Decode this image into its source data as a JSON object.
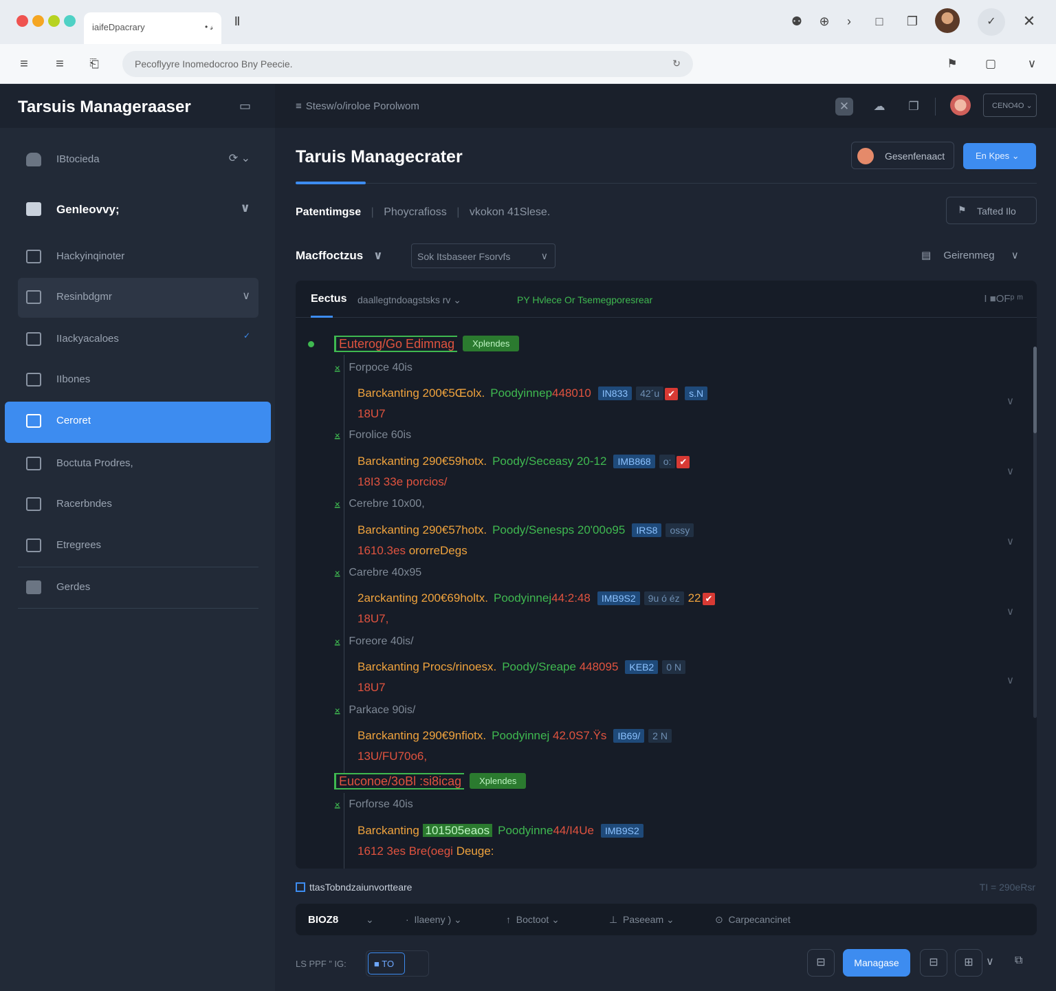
{
  "browser": {
    "tab_title": "iaifeDpacrary",
    "address": "Pecoflyyre Inomedocroo Bny Peecie.",
    "window_colors": [
      "#ef5350",
      "#f5a623",
      "#7ed321",
      "#4fd1c5"
    ]
  },
  "app": {
    "brand": "Tarsuis Manageraaser",
    "breadcrumb": "Stesw/o/iroloe  Porolwom",
    "top_select": "CENO4O",
    "page_title": "Taruis Managecrater",
    "header_button": "Gesenfenaact",
    "primary_button": "En Kpes",
    "sub_tabs": [
      "Patentimgse",
      "Phoycrafioss",
      "vkokon 41Slese."
    ],
    "tasks_button": "Tafted Ilo",
    "filter_label": "Macffoctzus",
    "filter_select": "Sok Itsbaseer Fsorvfs",
    "filter_right": "Geirenmeg"
  },
  "sidebar": {
    "items": [
      {
        "label": "IBtocieda",
        "extra": "⟳ ⌄"
      },
      {
        "label": "Genleovvy;"
      },
      {
        "label": "Hackyinqinoter"
      },
      {
        "label": "Resinbdgmr"
      },
      {
        "label": "IIackyacaloes",
        "extra": "✓"
      },
      {
        "label": "IIbones"
      },
      {
        "label": "Ceroret"
      },
      {
        "label": "Boctuta Prodres,"
      },
      {
        "label": "Racerbndes"
      },
      {
        "label": "Etregrees"
      },
      {
        "label": "Gerdes"
      }
    ]
  },
  "panel": {
    "tab": "Eectus",
    "filter": "daallegtndoagstsks rv ⌄",
    "status": "PY Hvlece Or Tsemegporesrear",
    "right": "I ■OFᵖ ᵐ",
    "groups": [
      {
        "title": "Euterog/Go Edimnag",
        "badge": "Xplendes",
        "entries": [
          {
            "sub": "Forpoce 40is",
            "a": "Barckanting 200€5Œolx.",
            "b": "Poodyinnep",
            "c": "448010",
            "tag": "IN833",
            "extra": "42´u",
            "mark": "✔",
            "tag2": "s.N",
            "line2": "18U7"
          },
          {
            "sub": "Forolice 60is",
            "a": "Barckanting 290€59hotx.",
            "b": "Poody/Seceasy 20-12",
            "c": "",
            "tag": "IMB868",
            "extra": "o:",
            "mark": "✔",
            "tag2": "",
            "line2": "18I3 33e",
            "line2b": "porcios/"
          },
          {
            "sub": "Cerebre 10x00,",
            "a": "Barckanting 290€57hotx.",
            "b": "Poody/Senesps 20'00o95",
            "c": "",
            "tag": "IRS8",
            "extra": "ossy",
            "mark": "",
            "tag2": "",
            "line2": "1610.3es",
            "line2b": "ororreDegs"
          },
          {
            "sub": "Carebre 40x95",
            "a": "2arckanting 200€69holtx.",
            "b": "Poodyinnej",
            "c": "44:2:48",
            "tag": "IMB9S2",
            "extra": "9u ó éz",
            "num": "22",
            "mark": "✔",
            "tag2": "",
            "line2": "18U7,"
          },
          {
            "sub": "Foreore 40is/",
            "a": "Barckanting Procs/rinoesx.",
            "b": "Poody/Sreape",
            "c": "448095",
            "tag": "KEB2",
            "extra": "",
            "mark": "",
            "tag2": "0 N",
            "line2": "18U7"
          },
          {
            "sub": "Parkace 90is/",
            "a": "Barckanting 290€9nfiotx.",
            "b": "Poodyinnej",
            "c": "42.0S7.Ÿs",
            "tag": "IB69/",
            "extra": "",
            "mark": "",
            "tag2": "2 N",
            "line2": "13U/FU70o6,"
          }
        ]
      },
      {
        "title": "Euconoe/3oBl :si8icag",
        "badge": "Xplendes",
        "entries": [
          {
            "sub": "Forforse 40is",
            "a": "Barckanting",
            "green": "101505eaos",
            "b": "Poodyinne",
            "c": "44/I4Ue",
            "tag": "IMB9S2",
            "extra": "",
            "mark": "",
            "tag2": "",
            "line2": "1612 3es",
            "line2b": "Bre(oegi",
            "line2c": "Deuge:"
          }
        ]
      }
    ]
  },
  "footer": {
    "title": "ttasTobndzaiunvortteare",
    "right": "TI = 290eRsr",
    "toolbar": [
      "BIOZ8",
      "⌄",
      "Ilaeeny ) ⌄",
      "Boctoot ⌄",
      "Paseeam ⌄",
      "Carpecancinet"
    ],
    "bottom_left": "LS PPF  ”  IG:",
    "chip": "TO",
    "manage_button": "Managase"
  }
}
